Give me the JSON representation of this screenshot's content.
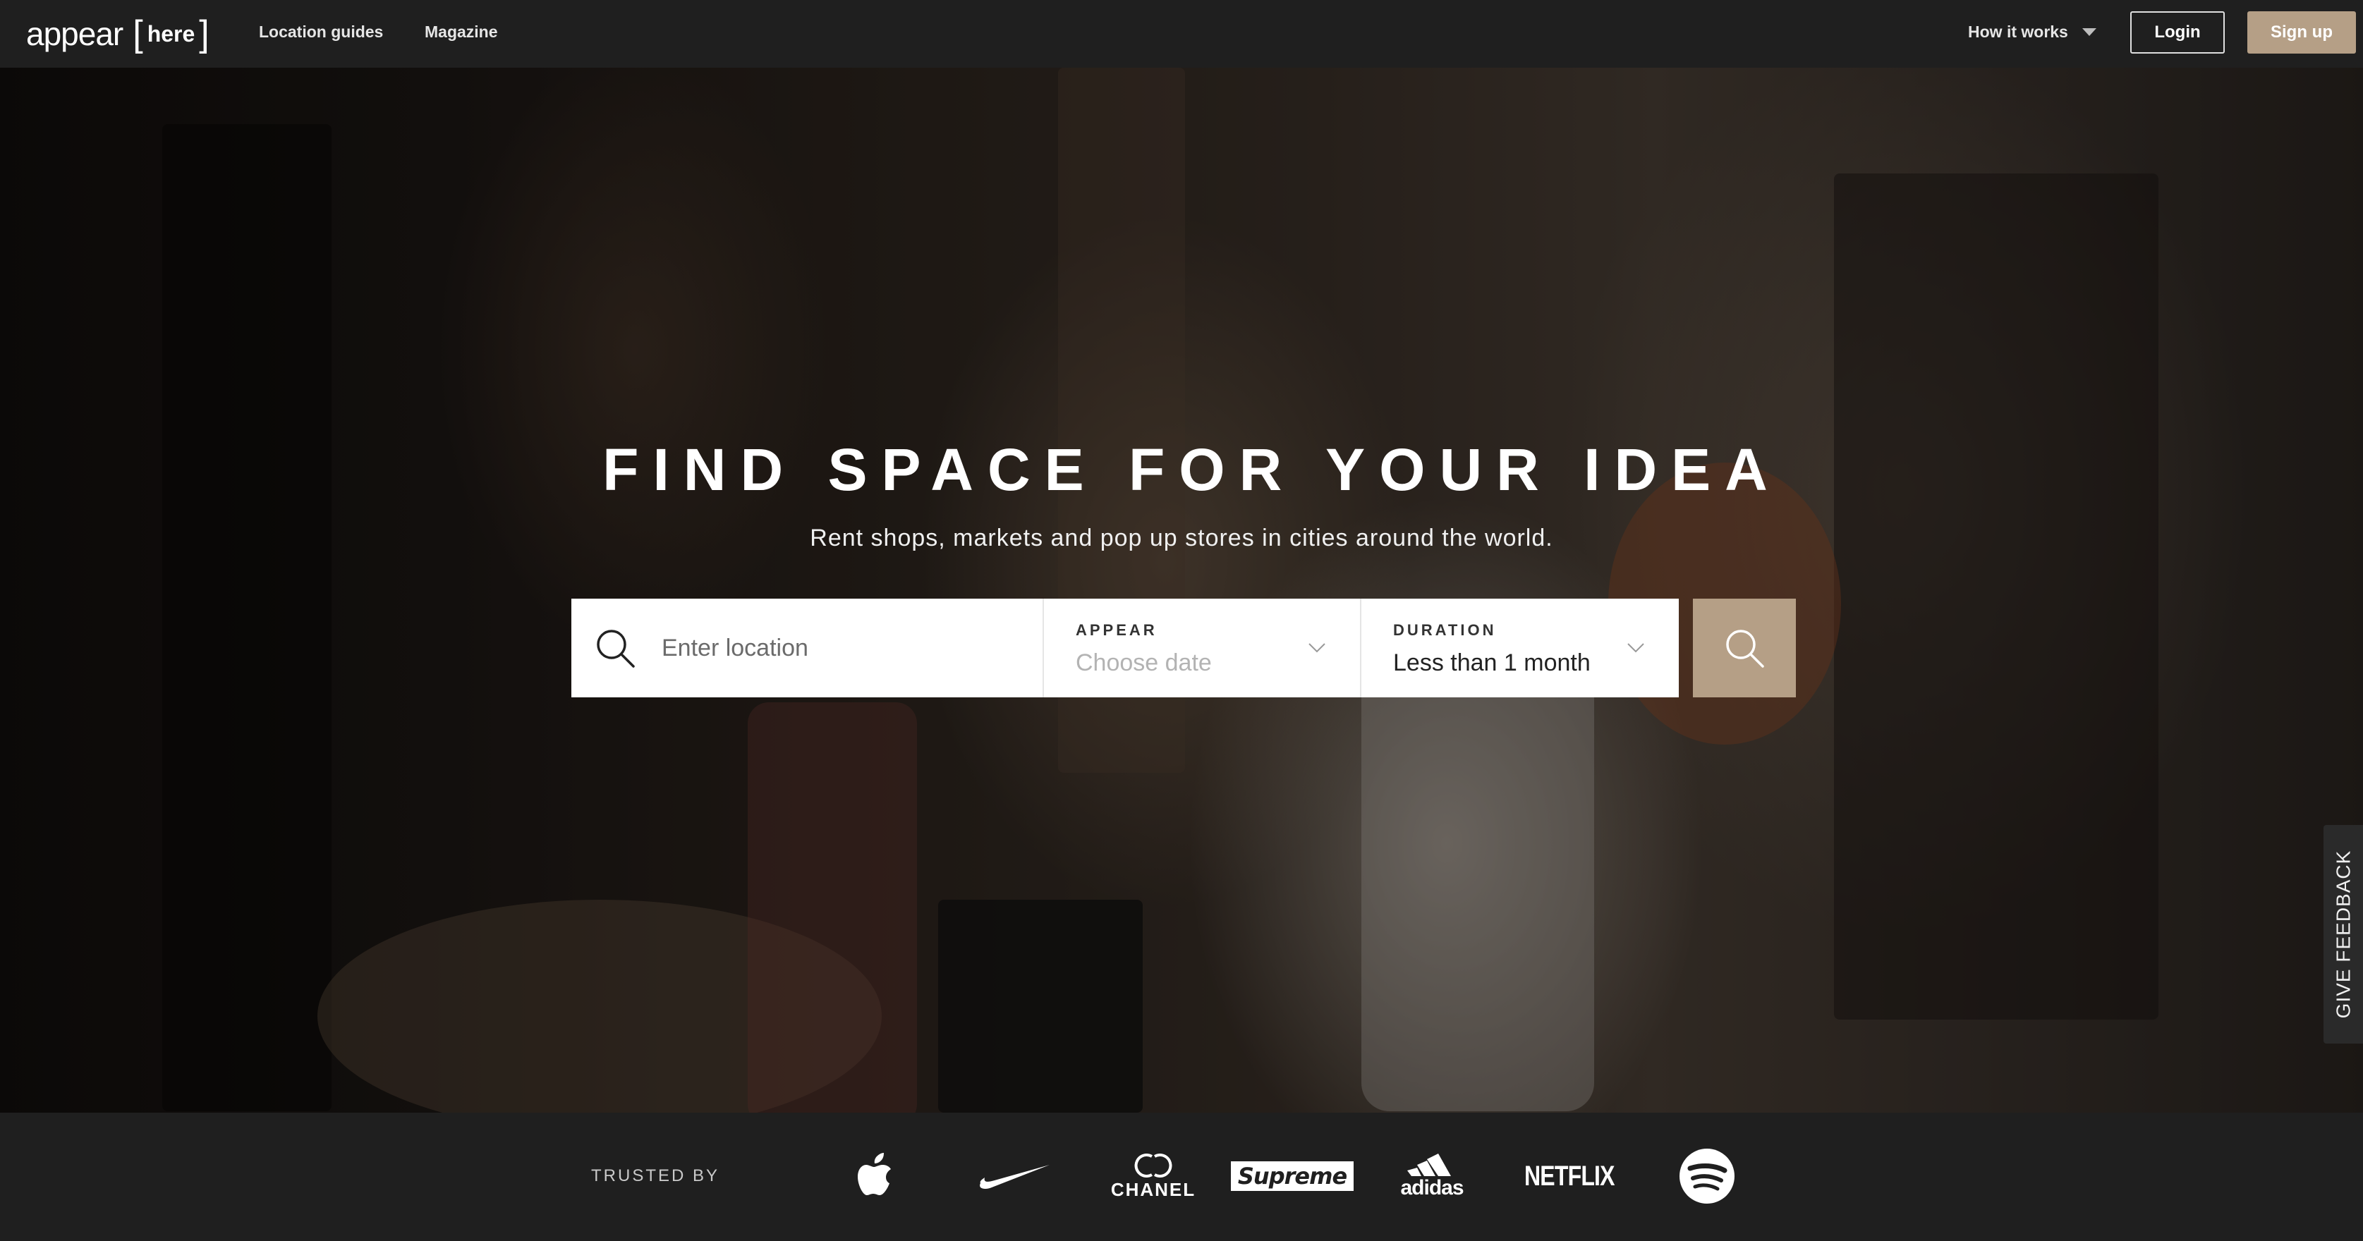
{
  "nav": {
    "logo_word": "appear",
    "logo_bracket_open": "[",
    "logo_here": "here",
    "logo_bracket_close": "]",
    "links": [
      "Location guides",
      "Magazine"
    ],
    "how_it_works": "How it works",
    "login": "Login",
    "signup": "Sign up"
  },
  "hero": {
    "title": "FIND SPACE FOR YOUR IDEA",
    "subtitle": "Rent shops, markets and pop up stores in cities around the world."
  },
  "search": {
    "location_placeholder": "Enter location",
    "appear_label": "APPEAR",
    "appear_value": "Choose date",
    "duration_label": "DURATION",
    "duration_value": "Less than 1 month"
  },
  "feedback": {
    "label": "GIVE FEEDBACK"
  },
  "trusted": {
    "label": "TRUSTED BY",
    "brands": [
      {
        "name": "Apple",
        "icon": "apple-logo"
      },
      {
        "name": "Nike",
        "icon": "nike-swoosh"
      },
      {
        "name": "Chanel",
        "wordmark": "CHANEL"
      },
      {
        "name": "Supreme",
        "wordmark": "Supreme"
      },
      {
        "name": "Adidas",
        "wordmark": "adidas"
      },
      {
        "name": "Netflix",
        "wordmark": "NETFLIX"
      },
      {
        "name": "Spotify",
        "icon": "spotify-logo"
      }
    ]
  },
  "colors": {
    "accent": "#b59f86",
    "nav_bg": "#1f1f1f",
    "search_bg": "#ffffff"
  }
}
